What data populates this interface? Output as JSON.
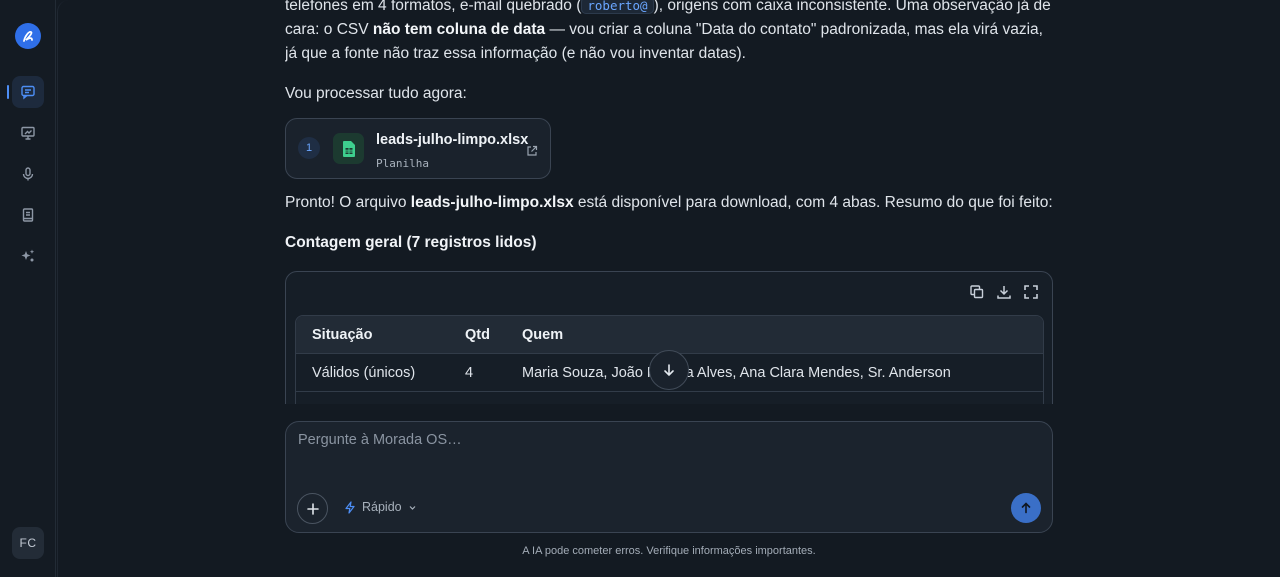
{
  "sidebar": {
    "logo_icon": "brand-logo-icon",
    "items": [
      {
        "icon": "chat-icon",
        "active": true
      },
      {
        "icon": "presentation-icon",
        "active": false
      },
      {
        "icon": "microphone-icon",
        "active": false
      },
      {
        "icon": "book-icon",
        "active": false
      },
      {
        "icon": "sparkles-icon",
        "active": false
      }
    ],
    "avatar": "FC",
    "accent": "#4d8ef5"
  },
  "message": {
    "p1_a": "telefones em 4 formatos, e-mail quebrado (",
    "p1_code": "roberto@",
    "p1_b": "), origens com caixa inconsistente. Uma observação já de cara: o CSV ",
    "p1_bold": "não tem coluna de data",
    "p1_c": " — vou criar a coluna \"Data do contato\" padronizada, mas ela virá vazia, já que a fonte não traz essa informação (e não vou inventar datas).",
    "p2": "Vou processar tudo agora:",
    "file": {
      "index": "1",
      "name": "leads-julho-limpo.xlsx",
      "type": "Planilha",
      "icon": "spreadsheet-icon",
      "icon_color": "#3ecf8e"
    },
    "p3_a": "Pronto! O arquivo ",
    "p3_bold": "leads-julho-limpo.xlsx",
    "p3_b": " está disponível para download, com 4 abas. Resumo do que foi feito:",
    "heading": "Contagem geral (7 registros lidos)",
    "table": {
      "headers": [
        "Situação",
        "Qtd",
        "Quem"
      ],
      "rows": [
        [
          "Válidos (únicos)",
          "4",
          "Maria Souza, João Pereira Alves, Ana Clara Mendes, Sr. Anderson"
        ]
      ]
    }
  },
  "composer": {
    "placeholder": "Pergunte à Morada OS…",
    "mode": "Rápido",
    "send_color": "#3a6fc7"
  },
  "disclaimer": "A IA pode cometer erros. Verifique informações importantes."
}
